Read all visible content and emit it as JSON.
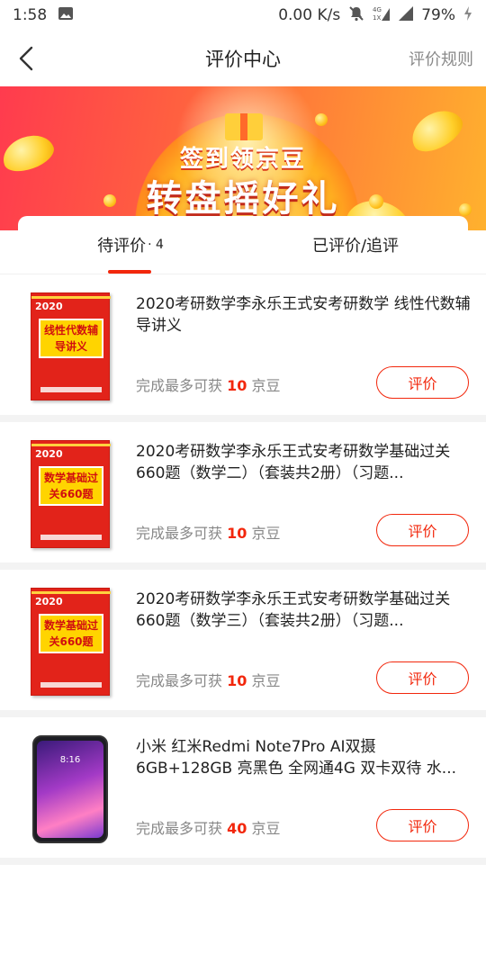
{
  "status_bar": {
    "time": "1:58",
    "network_speed": "0.00 K/s",
    "battery": "79%",
    "icons": [
      "image-icon",
      "mute-icon",
      "signal-4g-icon",
      "signal-icon",
      "battery-charging-icon"
    ]
  },
  "header": {
    "title": "评价中心",
    "rules_link": "评价规则"
  },
  "banner": {
    "line1": "签到领京豆",
    "line2": "转盘摇好礼"
  },
  "tabs": [
    {
      "label": "待评价",
      "count": "· 4",
      "active": true
    },
    {
      "label": "已评价/追评",
      "count": "",
      "active": false
    }
  ],
  "items": [
    {
      "title": "2020考研数学李永乐王式安考研数学 线性代数辅导讲义",
      "reward_prefix": "完成最多可获",
      "reward_amount": "10",
      "reward_unit": "京豆",
      "button": "评价",
      "thumb": {
        "kind": "book",
        "year": "2020",
        "label": "线性代数辅导讲义"
      }
    },
    {
      "title": "2020考研数学李永乐王式安考研数学基础过关660题（数学二）（套装共2册）（习题...",
      "reward_prefix": "完成最多可获",
      "reward_amount": "10",
      "reward_unit": "京豆",
      "button": "评价",
      "thumb": {
        "kind": "book",
        "year": "2020",
        "label": "数学基础过关660题"
      }
    },
    {
      "title": "2020考研数学李永乐王式安考研数学基础过关660题（数学三）（套装共2册）（习题...",
      "reward_prefix": "完成最多可获",
      "reward_amount": "10",
      "reward_unit": "京豆",
      "button": "评价",
      "thumb": {
        "kind": "book",
        "year": "2020",
        "label": "数学基础过关660题"
      }
    },
    {
      "title": "小米 红米Redmi Note7Pro AI双摄 6GB+128GB 亮黑色 全网通4G 双卡双待 水...",
      "reward_prefix": "完成最多可获",
      "reward_amount": "40",
      "reward_unit": "京豆",
      "button": "评价",
      "thumb": {
        "kind": "phone",
        "screen_time": "8:16"
      }
    }
  ],
  "colors": {
    "accent": "#f2270c",
    "muted_text": "#888888",
    "separator": "#f3f3f3"
  }
}
